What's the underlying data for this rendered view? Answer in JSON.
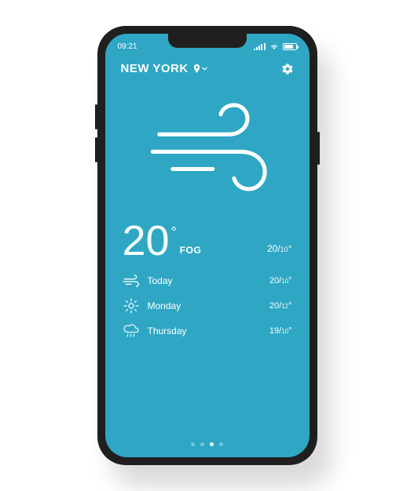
{
  "status": {
    "time": "09:21"
  },
  "header": {
    "city": "NEW YORK"
  },
  "current": {
    "temp": "20",
    "condition": "FOG",
    "high": "20",
    "low": "10"
  },
  "forecast": [
    {
      "icon": "wind",
      "label": "Today",
      "high": "20",
      "low": "10"
    },
    {
      "icon": "sun",
      "label": "Monday",
      "high": "20",
      "low": "12"
    },
    {
      "icon": "rain",
      "label": "Thursday",
      "high": "19",
      "low": "10"
    }
  ],
  "pager": {
    "count": 4,
    "active": 2
  }
}
